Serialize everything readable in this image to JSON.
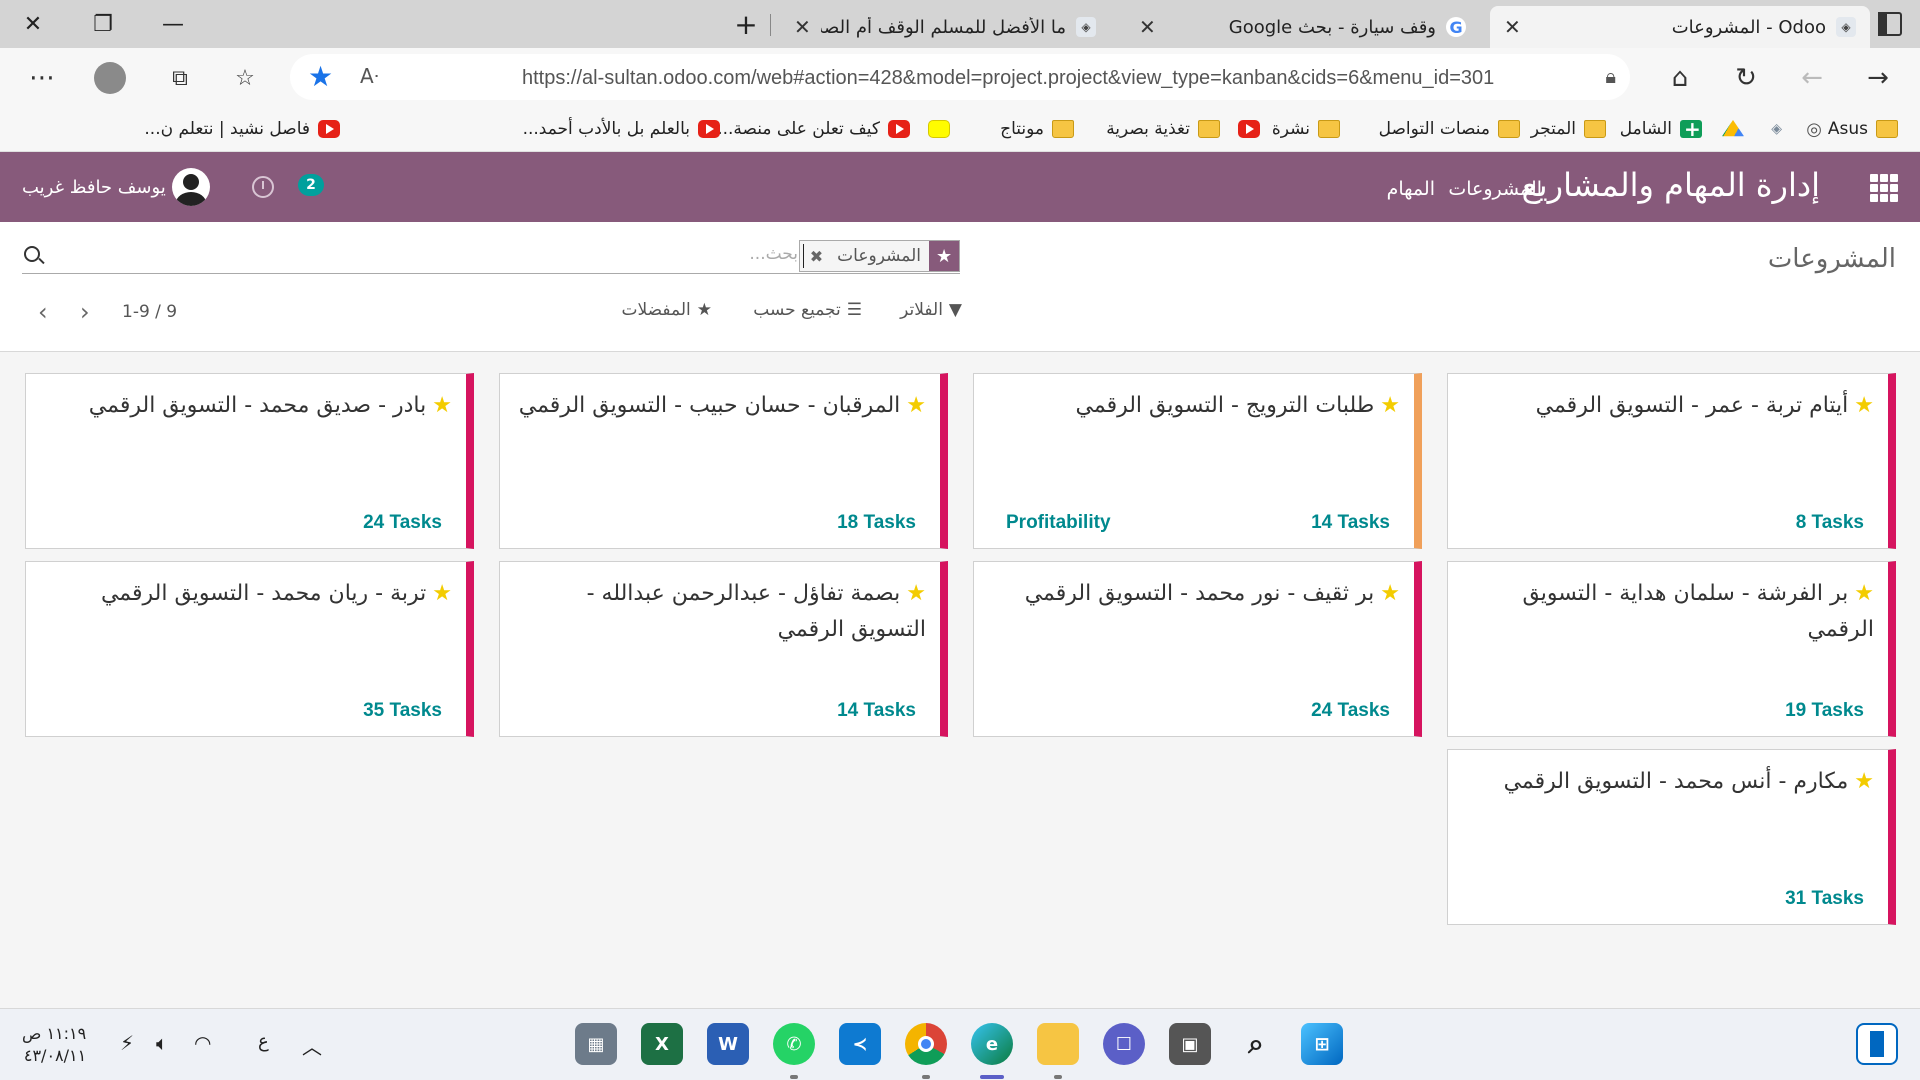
{
  "browser": {
    "tabs": [
      {
        "title": "Odoo - المشروعات",
        "active": true
      },
      {
        "title": "وقف سيارة - بحث Google",
        "active": false
      },
      {
        "title": "ما الأفضل للمسلم الوقف أم الصدق",
        "active": false
      }
    ],
    "url": "https://al-sultan.odoo.com/web#action=428&model=project.project&view_type=kanban&cids=6&menu_id=301",
    "url_host": "al-sultan.odoo.com",
    "bookmarks": [
      {
        "label": "Asus",
        "icon": "folder-icon"
      },
      {
        "label": "",
        "icon": "fingerprint-icon"
      },
      {
        "label": "",
        "icon": "app-icon"
      },
      {
        "label": "",
        "icon": "google-drive-icon"
      },
      {
        "label": "الشامل",
        "icon": "plus-icon"
      },
      {
        "label": "المتجر",
        "icon": "folder-icon"
      },
      {
        "label": "منصات التواصل",
        "icon": "folder-icon"
      },
      {
        "label": "نشرة",
        "icon": "folder-icon"
      },
      {
        "label": "",
        "icon": "youtube-icon"
      },
      {
        "label": "تغذية بصرية",
        "icon": "folder-icon"
      },
      {
        "label": "مونتاج",
        "icon": "folder-icon"
      },
      {
        "label": "",
        "icon": "snapchat-icon"
      },
      {
        "label": "كيف تعلن على منصة...",
        "icon": "youtube-icon"
      },
      {
        "label": "بالعلم بل بالأدب أحمد...",
        "icon": "youtube-icon"
      },
      {
        "label": "فاصل نشيد | نتعلم ن...",
        "icon": "youtube-icon"
      }
    ]
  },
  "odoo": {
    "brand": "إدارة المهام والمشاريع",
    "menu": [
      "المشروعات",
      "المهام"
    ],
    "user": "يوسف حافظ غريب",
    "messages_count": "2",
    "breadcrumb": "المشروعات",
    "search": {
      "facet": "المشروعات",
      "placeholder": "بحث..."
    },
    "filters_label": "الفلاتر",
    "groupby_label": "تجميع حسب",
    "favorites_label": "المفضلات",
    "pager": "1-9 / 9"
  },
  "projects": [
    {
      "title": "أيتام تربة - عمر - التسويق الرقمي",
      "tasks": "8 Tasks",
      "extra": "",
      "color": "#d6145f"
    },
    {
      "title": "طلبات الترويج - التسويق الرقمي",
      "tasks": "14 Tasks",
      "extra": "Profitability",
      "color": "#f0a05a"
    },
    {
      "title": "المرقبان - حسان حبيب - التسويق الرقمي",
      "tasks": "18 Tasks",
      "extra": "",
      "color": "#d6145f"
    },
    {
      "title": "بادر - صديق محمد - التسويق الرقمي",
      "tasks": "24 Tasks",
      "extra": "",
      "color": "#d6145f"
    },
    {
      "title": "بر الفرشة - سلمان هداية - التسويق الرقمي",
      "tasks": "19 Tasks",
      "extra": "",
      "color": "#d6145f"
    },
    {
      "title": "بر ثقيف - نور محمد - التسويق الرقمي",
      "tasks": "24 Tasks",
      "extra": "",
      "color": "#d6145f"
    },
    {
      "title": "بصمة تفاؤل - عبدالرحمن عبدالله - التسويق الرقمي",
      "tasks": "14 Tasks",
      "extra": "",
      "color": "#d6145f"
    },
    {
      "title": "تربة - ريان محمد - التسويق الرقمي",
      "tasks": "35 Tasks",
      "extra": "",
      "color": "#d6145f"
    },
    {
      "title": "مكارم - أنس محمد - التسويق الرقمي",
      "tasks": "31 Tasks",
      "extra": "",
      "color": "#d6145f"
    }
  ],
  "taskbar": {
    "apps": [
      "calculator-icon",
      "excel-icon",
      "word-icon",
      "whatsapp-icon",
      "vscode-icon",
      "chrome-icon",
      "edge-icon",
      "file-explorer-icon",
      "chat-icon",
      "app-icon",
      "search-icon",
      "start-icon"
    ],
    "lang": "ع",
    "time": "١١:١٩ ص",
    "date": "٤٣/٠٨/١١"
  }
}
